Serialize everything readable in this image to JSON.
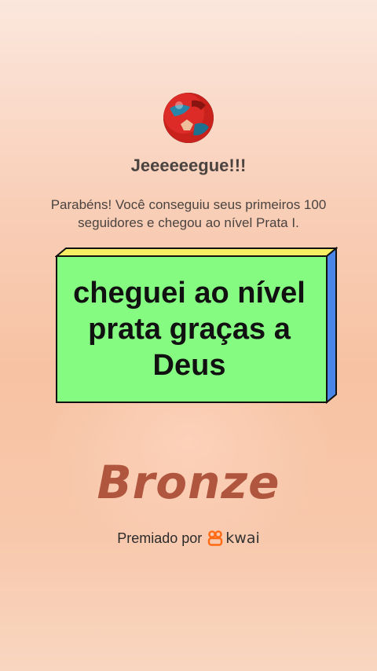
{
  "header": {
    "avatar_icon": "soccer-ball-icon",
    "title": "Jeeeeeegue!!!",
    "message": "Parabéns! Você conseguiu seus primeiros 100 seguidores e chegou ao nível Prata I."
  },
  "sticker": {
    "text": "cheguei ao nível prata graças a Deus",
    "colors": {
      "face": "#86fb81",
      "top": "#f6ee63",
      "side": "#4a86e8",
      "border": "#111111"
    }
  },
  "level": {
    "name": "Bronze",
    "color": "#b0563f"
  },
  "award": {
    "label": "Premiado por",
    "brand_icon": "kwai-logo-icon",
    "brand_name": "kwai",
    "brand_color": "#ff6a13"
  }
}
